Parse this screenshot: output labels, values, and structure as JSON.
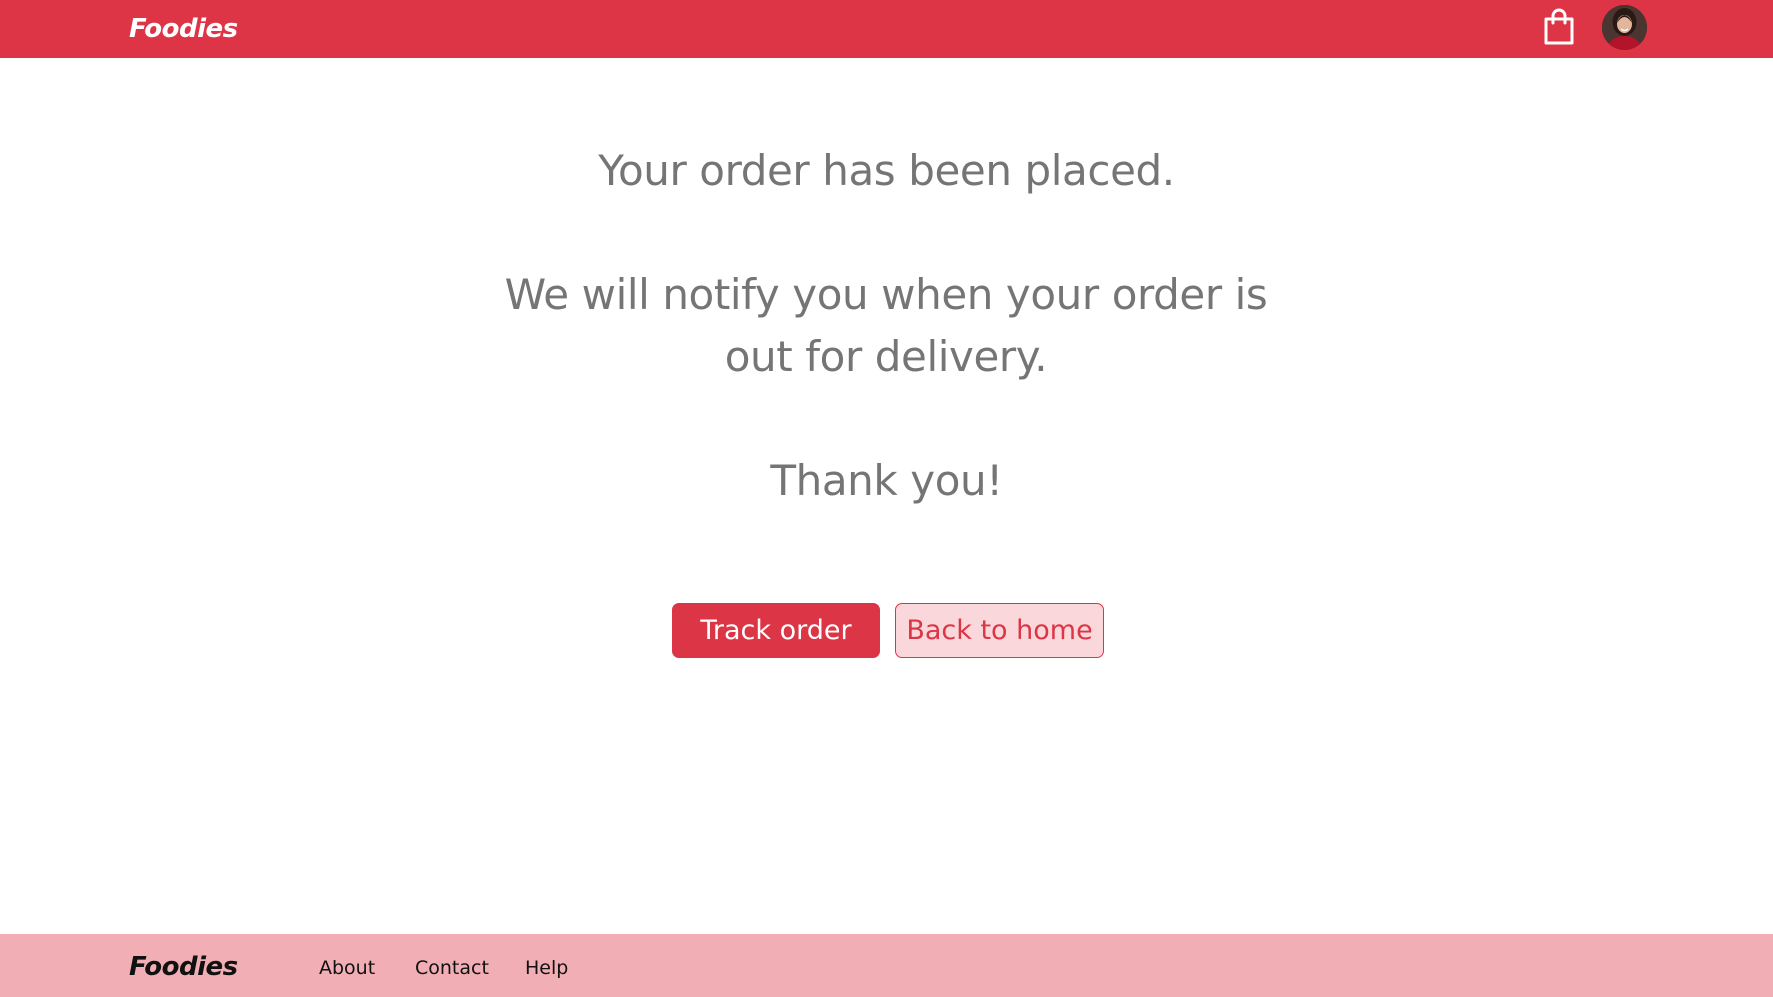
{
  "header": {
    "brand": "Foodies",
    "cart_icon": "shopping-bag-icon",
    "avatar": "user-avatar"
  },
  "confirmation": {
    "line1": "Your order has been placed.",
    "line2": "We will notify you when your order is out for delivery.",
    "line3": "Thank you!"
  },
  "actions": {
    "track_label": "Track order",
    "home_label": "Back to home"
  },
  "footer": {
    "brand": "Foodies",
    "links": [
      "About",
      "Contact",
      "Help"
    ]
  },
  "colors": {
    "brand_red": "#dd3546",
    "footer_pink": "#f2aeb5",
    "secondary_button_bg": "#f9d7db",
    "message_text": "#757575"
  }
}
